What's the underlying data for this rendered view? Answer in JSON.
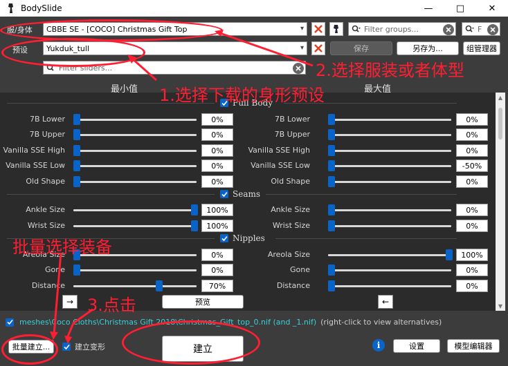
{
  "window": {
    "title": "BodySlide",
    "minimize": "—",
    "maximize": "□",
    "close": "✕"
  },
  "top": {
    "outfit_label": "服/身体",
    "outfit_value": "CBBE SE - [COCO] Christmas Gift Top",
    "preset_label": "预设",
    "preset_value": "Yukduk_tull",
    "filter_groups_placeholder": "Filter groups...",
    "filter_outfits_placeholder": "F",
    "save_label": "保存",
    "save_as_label": "另存为...",
    "group_manager_label": "组管理器",
    "filter_sliders_placeholder": "Filter sliders..."
  },
  "panel": {
    "min_header": "最小值",
    "max_header": "最大值",
    "groups": [
      {
        "name": "Full Body",
        "sliders": [
          {
            "name": "7B Lower",
            "min": 0,
            "max": 0,
            "min_text": "0%",
            "max_text": "0%"
          },
          {
            "name": "7B Upper",
            "min": 0,
            "max": 0,
            "min_text": "0%",
            "max_text": "0%"
          },
          {
            "name": "Vanilla SSE High",
            "min": 0,
            "max": 0,
            "min_text": "0%",
            "max_text": "0%"
          },
          {
            "name": "Vanilla SSE Low",
            "min": 0,
            "max": -50,
            "min_text": "0%",
            "max_text": "-50%"
          },
          {
            "name": "Old Shape",
            "min": 0,
            "max": 0,
            "min_text": "0%",
            "max_text": "0%"
          }
        ]
      },
      {
        "name": "Seams",
        "sliders": [
          {
            "name": "Ankle Size",
            "min": 100,
            "max": 0,
            "min_text": "100%",
            "max_text": "0%"
          },
          {
            "name": "Wrist Size",
            "min": 100,
            "max": 0,
            "min_text": "100%",
            "max_text": "0%"
          }
        ]
      },
      {
        "name": "Nipples",
        "sliders": [
          {
            "name": "Areola Size",
            "min": 0,
            "max": 100,
            "min_text": "0%",
            "max_text": "100%"
          },
          {
            "name": "Gone",
            "min": 0,
            "max": 0,
            "min_text": "0%",
            "max_text": "0%"
          },
          {
            "name": "Distance",
            "min": 70,
            "max": 0,
            "min_text": "70%",
            "max_text": "0%"
          }
        ]
      }
    ]
  },
  "bottom": {
    "right_arrow": "→",
    "left_arrow": "←",
    "preview_label": "预览",
    "outfit_path": "meshes\\Coco Cloths\\Christmas Gift 2018\\Christmas_Gift_top_0.nif (and _1.nif)",
    "outfit_hint": "(right-click to view alternatives)",
    "batch_build_label": "批量建立...",
    "build_morphs_label": "建立变形",
    "build_label": "建立",
    "settings_label": "设置",
    "outfit_studio_label": "模型编辑器",
    "info_icon": "i"
  },
  "annotations": {
    "a1": "1.选择下载的身形预设",
    "a2": "2.选择服装或者体型",
    "a3": "3.点击",
    "a4": "批量选择装备"
  },
  "colors": {
    "accent": "#0a64c8",
    "annotation": "#ff1e32",
    "path": "#3ccfd8"
  }
}
